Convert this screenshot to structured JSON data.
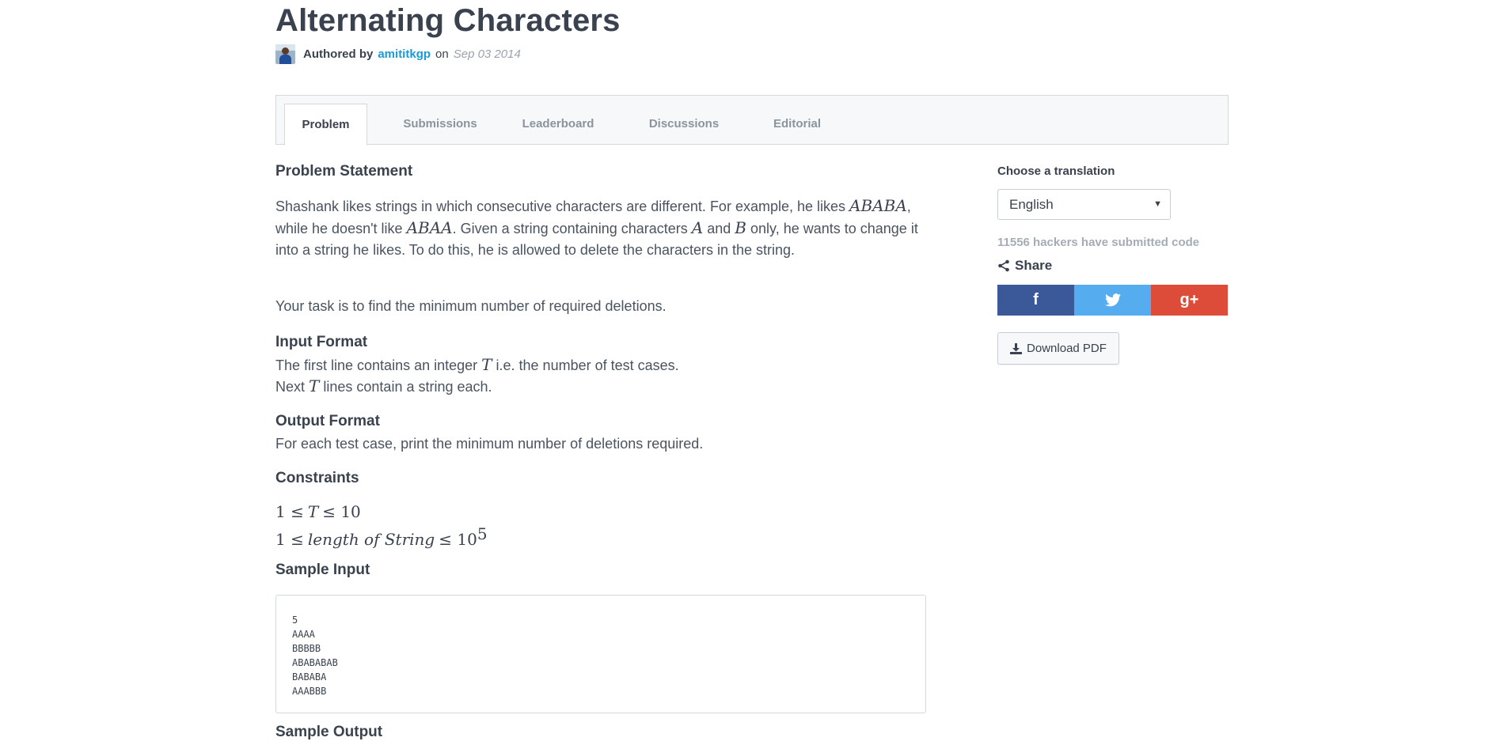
{
  "header": {
    "title": "Alternating Characters",
    "authored_by": "Authored by",
    "author": "amititkgp",
    "on": "on",
    "date": "Sep 03 2014"
  },
  "tabs": [
    {
      "label": "Problem",
      "active": true
    },
    {
      "label": "Submissions",
      "active": false
    },
    {
      "label": "Leaderboard",
      "active": false
    },
    {
      "label": "Discussions",
      "active": false
    },
    {
      "label": "Editorial",
      "active": false
    }
  ],
  "problem": {
    "statement_heading": "Problem Statement",
    "statement_p1": {
      "t1": "Shashank likes strings in which consecutive characters are different. For example, he likes",
      "m1": "ABABA",
      "t2": ", while he doesn't like",
      "m2": "ABAA",
      "t3": ". Given a string containing characters",
      "m3": "A",
      "t4": "and",
      "m4": "B",
      "t5": "only, he wants to change it into a string he likes. To do this, he is allowed to delete the characters in the string."
    },
    "statement_p2": "Your task is to find the minimum number of required deletions.",
    "input_heading": "Input Format",
    "input_line1_a": "The first line contains an integer",
    "input_line1_m": "T",
    "input_line1_b": "i.e. the number of test cases.",
    "input_line2_a": "Next",
    "input_line2_m": "T",
    "input_line2_b": "lines contain a string each.",
    "output_heading": "Output Format",
    "output_text": "For each test case, print the minimum number of deletions required.",
    "constraints_heading": "Constraints",
    "constraint1": {
      "a": "1 ≤",
      "m": "T",
      "b": "≤ 10"
    },
    "constraint2": {
      "a": "1 ≤",
      "m": "length of String",
      "b": "≤ 10",
      "exp": "5"
    },
    "sample_input_heading": "Sample Input",
    "sample_input": "5\nAAAA\nBBBBB\nABABABAB\nBABABA\nAAABBB",
    "sample_output_heading": "Sample Output"
  },
  "sidebar": {
    "translation_label": "Choose a translation",
    "translation_value": "English",
    "submitted_text": "11556 hackers have submitted code",
    "share_label": "Share",
    "social": {
      "facebook": "f",
      "twitter_icon": "twitter-icon",
      "googleplus": "g+"
    },
    "download_label": "Download PDF"
  },
  "colors": {
    "link": "#1a9bd7",
    "facebook": "#3b5998",
    "twitter": "#55acee",
    "googleplus": "#dd4b39"
  }
}
